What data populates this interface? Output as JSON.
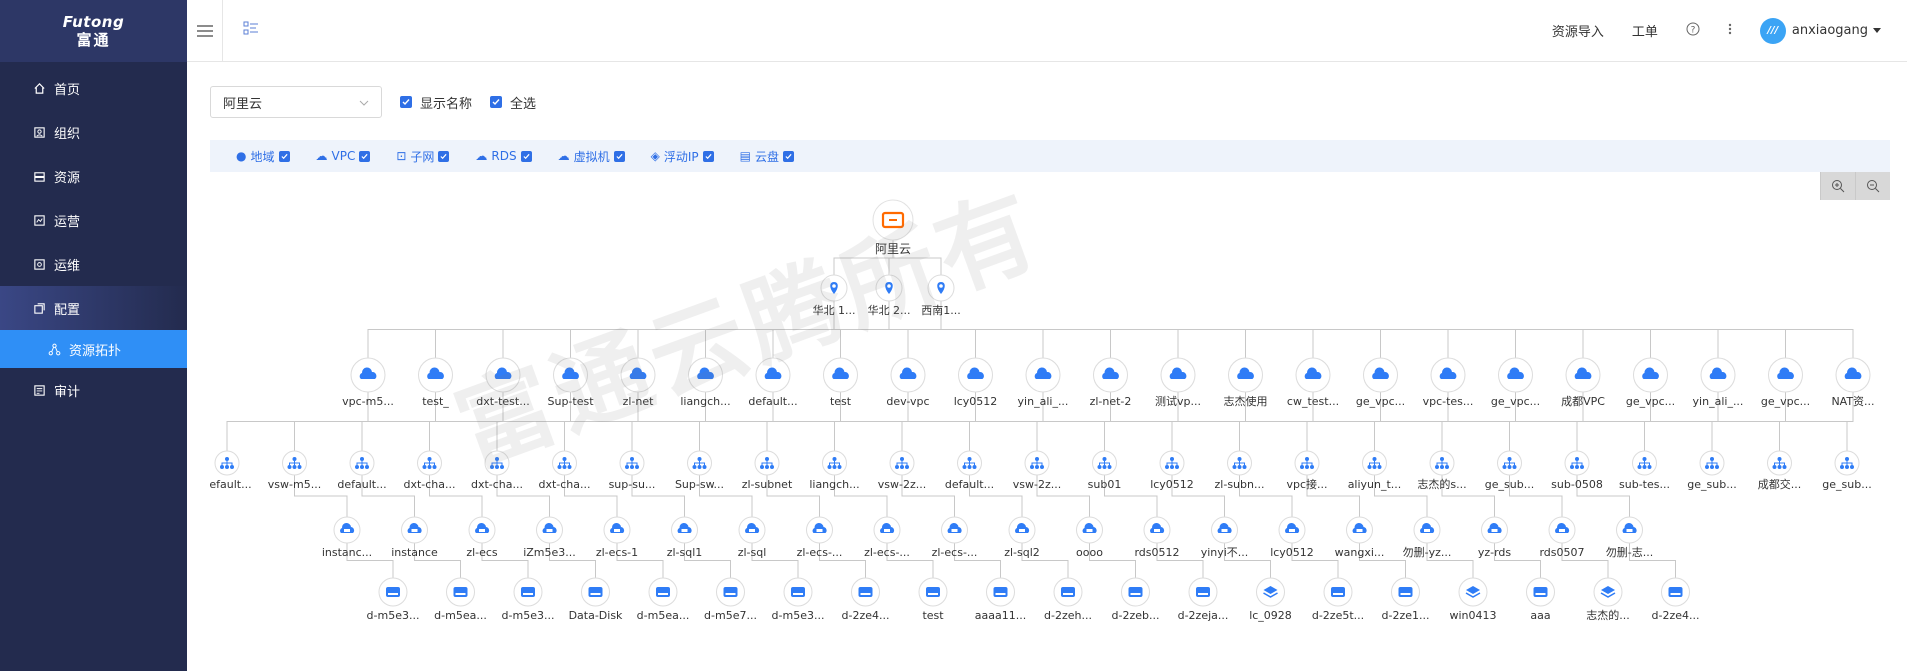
{
  "brand": {
    "en": "Futong",
    "zh": "富通"
  },
  "sidebar": {
    "items": [
      {
        "label": "首页",
        "icon": "home-icon"
      },
      {
        "label": "组织",
        "icon": "org-icon"
      },
      {
        "label": "资源",
        "icon": "resource-icon"
      },
      {
        "label": "运营",
        "icon": "operation-icon"
      },
      {
        "label": "运维",
        "icon": "maintenance-icon"
      },
      {
        "label": "配置",
        "icon": "config-icon"
      },
      {
        "label": "审计",
        "icon": "audit-icon"
      }
    ],
    "sub_item": {
      "label": "资源拓扑",
      "icon": "topology-icon"
    }
  },
  "header": {
    "import_label": "资源导入",
    "ticket_label": "工单",
    "username": "anxiaogang",
    "avatar_text": "///"
  },
  "toolbar": {
    "provider": "阿里云",
    "show_names": "显示名称",
    "select_all": "全选"
  },
  "filters": [
    "地域",
    "VPC",
    "子网",
    "RDS",
    "虚拟机",
    "浮动IP",
    "云盘"
  ],
  "watermark": "富通云腾所有",
  "topology": {
    "root": "阿里云",
    "regions": [
      "华北 1...",
      "华北 2...",
      "西南1..."
    ],
    "vpcs": [
      "vpc-m5...",
      "test_",
      "dxt-test...",
      "Sup-test",
      "zl-net",
      "liangch...",
      "default...",
      "test",
      "dev-vpc",
      "lcy0512",
      "yin_ali_...",
      "zl-net-2",
      "测试vp...",
      "志杰使用",
      "cw_test...",
      "ge_vpc...",
      "vpc-tes...",
      "ge_vpc...",
      "成都VPC",
      "ge_vpc...",
      "yin_ali_...",
      "ge_vpc...",
      "NAT资..."
    ],
    "subnets": [
      "default...",
      "vsw-m5...",
      "default...",
      "dxt-cha...",
      "dxt-cha...",
      "dxt-cha...",
      "sup-su...",
      "Sup-sw...",
      "zl-subnet",
      "liangch...",
      "vsw-2z...",
      "default...",
      "vsw-2z...",
      "sub01",
      "lcy0512",
      "zl-subn...",
      "vpc接...",
      "aliyun_t...",
      "志杰的s...",
      "ge_sub...",
      "sub-0508",
      "sub-tes...",
      "ge_sub...",
      "成都交...",
      "ge_sub..."
    ],
    "instances": [
      "instanc...",
      "instance",
      "zl-ecs",
      "iZm5e3...",
      "zl-ecs-1",
      "zl-sql1",
      "zl-sql",
      "zl-ecs-...",
      "zl-ecs-...",
      "zl-ecs-...",
      "zl-sql2",
      "oooo",
      "rds0512",
      "yinyi不...",
      "lcy0512",
      "wangxi...",
      "勿删-yz...",
      "yz-rds",
      "rds0507",
      "勿删-志..."
    ],
    "disks": [
      "d-m5e3...",
      "d-m5ea...",
      "d-m5e3...",
      "Data-Disk",
      "d-m5ea...",
      "d-m5e7...",
      "d-m5e3...",
      "d-2ze4...",
      "test",
      "aaaa11...",
      "d-2zeh...",
      "d-2zeb...",
      "d-2zeja...",
      "lc_0928",
      "d-2ze5t...",
      "d-2ze1...",
      "win0413",
      "aaa",
      "志杰的...",
      "d-2ze4..."
    ]
  },
  "colors": {
    "accent": "#2f6fe6",
    "sidebar": "#232b4e",
    "active": "#2f8ff6",
    "node": "#2f7cf6",
    "root": "#ff6a00"
  }
}
